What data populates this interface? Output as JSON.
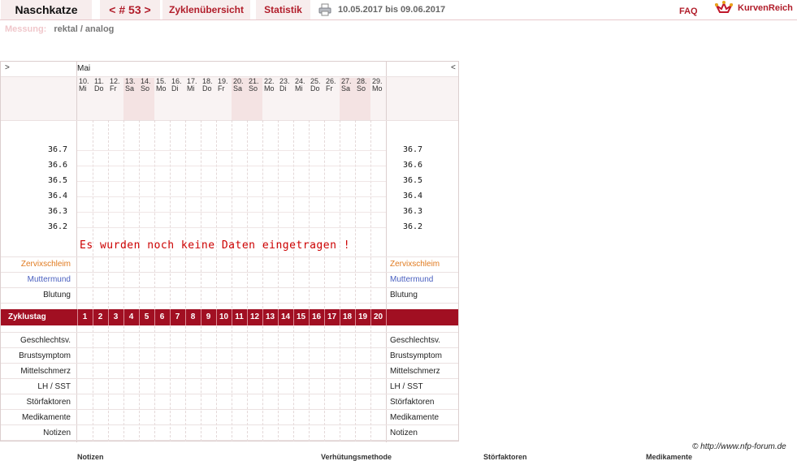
{
  "header": {
    "user": "Naschkatze",
    "cycle": "< # 53 >",
    "overview": "Zyklenübersicht",
    "stats": "Statistik",
    "date_range": "10.05.2017 bis 09.06.2017",
    "faq": "FAQ",
    "brand": "KurvenReich"
  },
  "measurement": {
    "label": "Messung:",
    "value": "rektal / analog"
  },
  "chart": {
    "nav_left": ">",
    "nav_right": "<",
    "month": "Mai",
    "days": [
      {
        "d": "10.",
        "w": "Mi",
        "weekend": false
      },
      {
        "d": "11.",
        "w": "Do",
        "weekend": false
      },
      {
        "d": "12.",
        "w": "Fr",
        "weekend": false
      },
      {
        "d": "13.",
        "w": "Sa",
        "weekend": true
      },
      {
        "d": "14.",
        "w": "So",
        "weekend": true
      },
      {
        "d": "15.",
        "w": "Mo",
        "weekend": false
      },
      {
        "d": "16.",
        "w": "Di",
        "weekend": false
      },
      {
        "d": "17.",
        "w": "Mi",
        "weekend": false
      },
      {
        "d": "18.",
        "w": "Do",
        "weekend": false
      },
      {
        "d": "19.",
        "w": "Fr",
        "weekend": false
      },
      {
        "d": "20.",
        "w": "Sa",
        "weekend": true
      },
      {
        "d": "21.",
        "w": "So",
        "weekend": true
      },
      {
        "d": "22.",
        "w": "Mo",
        "weekend": false
      },
      {
        "d": "23.",
        "w": "Di",
        "weekend": false
      },
      {
        "d": "24.",
        "w": "Mi",
        "weekend": false
      },
      {
        "d": "25.",
        "w": "Do",
        "weekend": false
      },
      {
        "d": "26.",
        "w": "Fr",
        "weekend": false
      },
      {
        "d": "27.",
        "w": "Sa",
        "weekend": true
      },
      {
        "d": "28.",
        "w": "So",
        "weekend": true
      },
      {
        "d": "29.",
        "w": "Mo",
        "weekend": false
      }
    ],
    "temperatures": [
      "36.7",
      "36.6",
      "36.5",
      "36.4",
      "36.3",
      "36.2"
    ],
    "no_data_message": "Es wurden noch keine Daten eingetragen !",
    "upper_rows": [
      "Zervixschleim",
      "Muttermund",
      "Blutung"
    ],
    "cycle_label": "Zyklustag",
    "cycle_days": [
      "1",
      "2",
      "3",
      "4",
      "5",
      "6",
      "7",
      "8",
      "9",
      "10",
      "11",
      "12",
      "13",
      "14",
      "15",
      "16",
      "17",
      "18",
      "19",
      "20"
    ],
    "lower_rows": [
      "Geschlechtsv.",
      "Brustsymptom",
      "Mittelschmerz",
      "LH / SST",
      "Störfaktoren",
      "Medikamente",
      "Notizen"
    ]
  },
  "footer": {
    "copyright": "© http://www.nfp-forum.de",
    "bottom_headers": [
      "Notizen",
      "Verhütungsmethode",
      "Störfaktoren",
      "Medikamente"
    ]
  }
}
